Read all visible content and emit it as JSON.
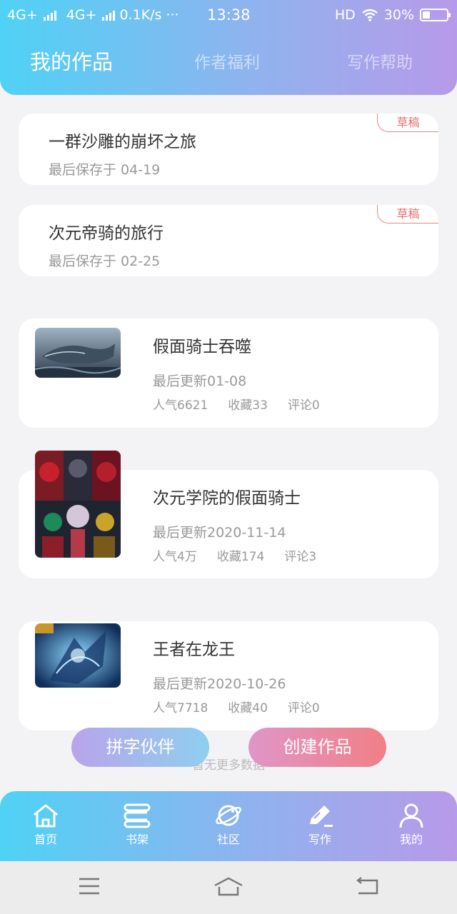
{
  "status_bar": {
    "carrier1": "4G+",
    "carrier2": "4G+",
    "speed": "0.1K/s",
    "dots": "···",
    "time": "13:38",
    "hd": "HD",
    "battery": "30%"
  },
  "tabs": [
    {
      "label": "我的作品",
      "active": true
    },
    {
      "label": "作者福利",
      "active": false
    },
    {
      "label": "写作帮助",
      "active": false
    }
  ],
  "drafts": [
    {
      "title": "一群沙雕的崩坏之旅",
      "saved": "最后保存于 04-19",
      "badge": "草稿"
    },
    {
      "title": "次元帝骑的旅行",
      "saved": "最后保存于 02-25",
      "badge": "草稿"
    }
  ],
  "works": [
    {
      "title": "假面骑士吞噬",
      "updated": "最后更新01-08",
      "popularity": "人气6621",
      "favorites": "收藏33",
      "comments": "评论0"
    },
    {
      "title": "次元学院的假面骑士",
      "updated": "最后更新2020-11-14",
      "popularity": "人气4万",
      "favorites": "收藏174",
      "comments": "评论3"
    },
    {
      "title": "王者在龙王",
      "updated": "最后更新2020-10-26",
      "popularity": "人气7718",
      "favorites": "收藏40",
      "comments": "评论0"
    }
  ],
  "no_more": "暂无更多数据",
  "buttons": {
    "partner": "拼字伙伴",
    "create": "创建作品"
  },
  "bottom_nav": [
    {
      "label": "首页",
      "icon": "home-icon"
    },
    {
      "label": "书架",
      "icon": "bookshelf-icon"
    },
    {
      "label": "社区",
      "icon": "planet-icon"
    },
    {
      "label": "写作",
      "icon": "pen-icon"
    },
    {
      "label": "我的",
      "icon": "user-icon"
    }
  ],
  "colors": {
    "header_start": "#4fd2f5",
    "header_end": "#b79ae9",
    "draft_badge": "#e0716c"
  }
}
